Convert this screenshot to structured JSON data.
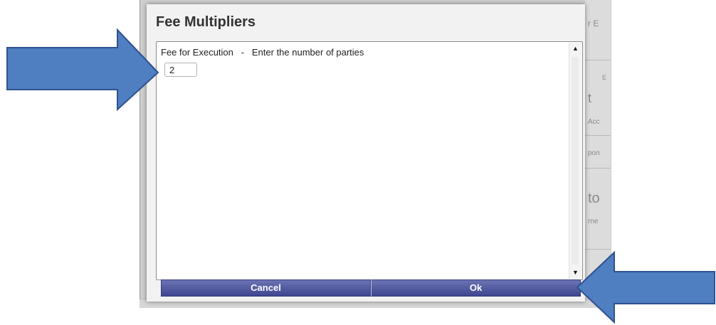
{
  "dialog": {
    "title": "Fee Multipliers",
    "field_label": "Fee for Execution   -   Enter the number of parties",
    "field_value": "2",
    "cancel_label": "Cancel",
    "ok_label": "Ok"
  },
  "background": {
    "fragments": [
      "r E",
      "E",
      "t",
      "Acc",
      "pon",
      "to",
      "rne"
    ]
  },
  "icons": {
    "scroll_up": "▲",
    "scroll_down": "▼"
  },
  "colors": {
    "arrow_fill": "#4f7fc0",
    "arrow_stroke": "#2f528f",
    "button_top": "#6b73b4",
    "button_bottom": "#3e4690"
  }
}
